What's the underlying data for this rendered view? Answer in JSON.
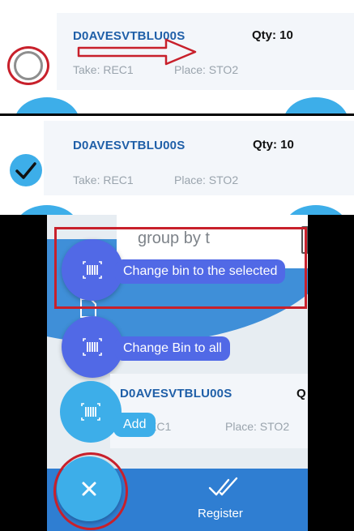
{
  "panel1": {
    "item": {
      "code": "D0AVESVTBLU00S",
      "qty": "Qty: 10",
      "take": "Take: REC1",
      "place": "Place: STO2"
    }
  },
  "panel2": {
    "item": {
      "code": "D0AVESVTBLU00S",
      "qty": "Qty: 10",
      "take": "Take: REC1",
      "place": "Place: STO2"
    }
  },
  "panel3": {
    "search_text": "group by t",
    "actions": {
      "change_selected": "Change bin to the selected",
      "change_all": "Change Bin to all",
      "add": "Add"
    },
    "item": {
      "code": "D0AVESVTBLU00S",
      "qty_partial": "Q",
      "take_partial": "EC1",
      "place": "Place: STO2"
    },
    "bottom": {
      "register_label": "Register"
    }
  },
  "colors": {
    "accent_blue": "#3daee9",
    "fab_indigo": "#5169e6",
    "bar_blue": "#2f7ed2",
    "code_blue": "#1f5fa8",
    "annotation_red": "#c8202b"
  },
  "icons": [
    "radio-unchecked-icon",
    "check-icon",
    "arrow-annotation-icon",
    "barcode-scan-icon",
    "close-icon",
    "double-check-icon",
    "document-icon"
  ]
}
